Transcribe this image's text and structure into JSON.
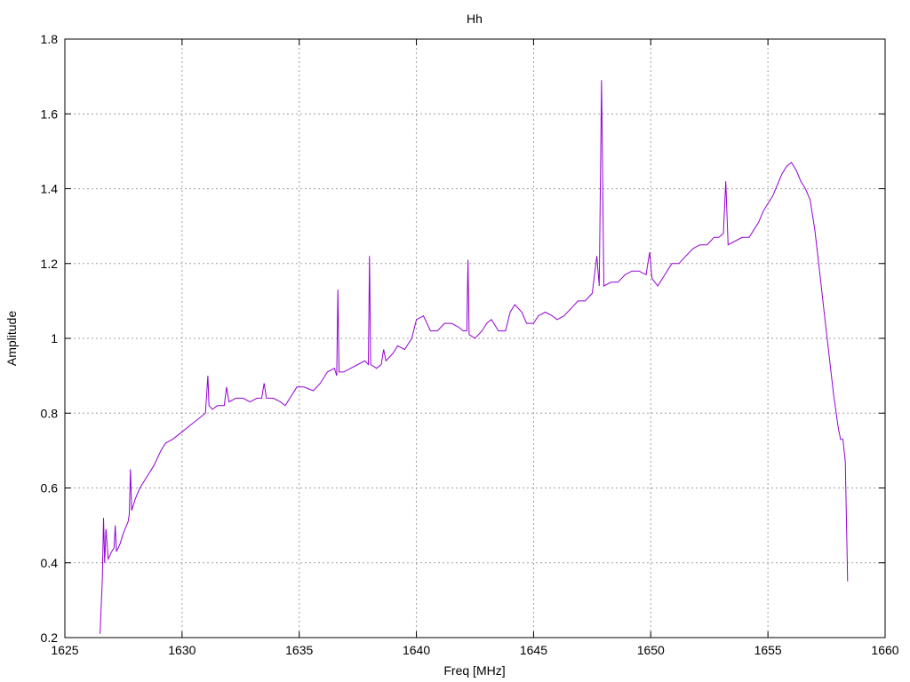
{
  "chart_data": {
    "type": "line",
    "title": "Hh",
    "xlabel": "Freq [MHz]",
    "ylabel": "Amplitude",
    "xlim": [
      1625,
      1660
    ],
    "ylim": [
      0.2,
      1.8
    ],
    "grid": true,
    "x_ticks": [
      {
        "value": 1625,
        "label": "1625"
      },
      {
        "value": 1630,
        "label": "1630"
      },
      {
        "value": 1635,
        "label": "1635"
      },
      {
        "value": 1640,
        "label": "1640"
      },
      {
        "value": 1645,
        "label": "1645"
      },
      {
        "value": 1650,
        "label": "1650"
      },
      {
        "value": 1655,
        "label": "1655"
      },
      {
        "value": 1660,
        "label": "1660"
      }
    ],
    "y_ticks": [
      {
        "value": 0.2,
        "label": "0.2"
      },
      {
        "value": 0.4,
        "label": "0.4"
      },
      {
        "value": 0.6,
        "label": "0.6"
      },
      {
        "value": 0.8,
        "label": "0.8"
      },
      {
        "value": 1.0,
        "label": "1"
      },
      {
        "value": 1.2,
        "label": "1.2"
      },
      {
        "value": 1.4,
        "label": "1.4"
      },
      {
        "value": 1.6,
        "label": "1.6"
      },
      {
        "value": 1.8,
        "label": "1.8"
      }
    ],
    "series": [
      {
        "color": "#9400d3",
        "points": [
          [
            1626.5,
            0.21
          ],
          [
            1626.6,
            0.36
          ],
          [
            1626.65,
            0.52
          ],
          [
            1626.7,
            0.4
          ],
          [
            1626.75,
            0.49
          ],
          [
            1626.85,
            0.41
          ],
          [
            1627.0,
            0.43
          ],
          [
            1627.1,
            0.44
          ],
          [
            1627.15,
            0.5
          ],
          [
            1627.2,
            0.43
          ],
          [
            1627.35,
            0.45
          ],
          [
            1627.5,
            0.48
          ],
          [
            1627.7,
            0.51
          ],
          [
            1627.75,
            0.53
          ],
          [
            1627.8,
            0.65
          ],
          [
            1627.85,
            0.54
          ],
          [
            1628.0,
            0.57
          ],
          [
            1628.2,
            0.6
          ],
          [
            1628.5,
            0.63
          ],
          [
            1628.8,
            0.66
          ],
          [
            1629.1,
            0.7
          ],
          [
            1629.3,
            0.72
          ],
          [
            1629.6,
            0.73
          ],
          [
            1630.0,
            0.75
          ],
          [
            1630.4,
            0.77
          ],
          [
            1630.8,
            0.79
          ],
          [
            1631.0,
            0.8
          ],
          [
            1631.1,
            0.9
          ],
          [
            1631.15,
            0.82
          ],
          [
            1631.3,
            0.81
          ],
          [
            1631.5,
            0.82
          ],
          [
            1631.8,
            0.82
          ],
          [
            1631.9,
            0.87
          ],
          [
            1632.0,
            0.83
          ],
          [
            1632.3,
            0.84
          ],
          [
            1632.6,
            0.84
          ],
          [
            1632.9,
            0.83
          ],
          [
            1633.2,
            0.84
          ],
          [
            1633.4,
            0.84
          ],
          [
            1633.5,
            0.88
          ],
          [
            1633.6,
            0.84
          ],
          [
            1633.9,
            0.84
          ],
          [
            1634.2,
            0.83
          ],
          [
            1634.4,
            0.82
          ],
          [
            1634.6,
            0.84
          ],
          [
            1634.9,
            0.87
          ],
          [
            1635.2,
            0.87
          ],
          [
            1635.6,
            0.86
          ],
          [
            1635.9,
            0.88
          ],
          [
            1636.2,
            0.91
          ],
          [
            1636.5,
            0.92
          ],
          [
            1636.6,
            0.9
          ],
          [
            1636.65,
            1.13
          ],
          [
            1636.7,
            0.91
          ],
          [
            1636.9,
            0.91
          ],
          [
            1637.2,
            0.92
          ],
          [
            1637.5,
            0.93
          ],
          [
            1637.8,
            0.94
          ],
          [
            1637.95,
            0.93
          ],
          [
            1638.0,
            1.22
          ],
          [
            1638.05,
            0.93
          ],
          [
            1638.3,
            0.92
          ],
          [
            1638.5,
            0.93
          ],
          [
            1638.6,
            0.97
          ],
          [
            1638.7,
            0.94
          ],
          [
            1639.0,
            0.96
          ],
          [
            1639.2,
            0.98
          ],
          [
            1639.5,
            0.97
          ],
          [
            1639.8,
            1.0
          ],
          [
            1640.0,
            1.05
          ],
          [
            1640.3,
            1.06
          ],
          [
            1640.6,
            1.02
          ],
          [
            1640.9,
            1.02
          ],
          [
            1641.2,
            1.04
          ],
          [
            1641.5,
            1.04
          ],
          [
            1641.8,
            1.03
          ],
          [
            1642.0,
            1.02
          ],
          [
            1642.15,
            1.02
          ],
          [
            1642.2,
            1.21
          ],
          [
            1642.25,
            1.01
          ],
          [
            1642.5,
            1.0
          ],
          [
            1642.8,
            1.02
          ],
          [
            1643.0,
            1.04
          ],
          [
            1643.2,
            1.05
          ],
          [
            1643.5,
            1.02
          ],
          [
            1643.8,
            1.02
          ],
          [
            1644.0,
            1.07
          ],
          [
            1644.2,
            1.09
          ],
          [
            1644.5,
            1.07
          ],
          [
            1644.7,
            1.04
          ],
          [
            1645.0,
            1.04
          ],
          [
            1645.2,
            1.06
          ],
          [
            1645.5,
            1.07
          ],
          [
            1645.8,
            1.06
          ],
          [
            1646.0,
            1.05
          ],
          [
            1646.3,
            1.06
          ],
          [
            1646.6,
            1.08
          ],
          [
            1646.9,
            1.1
          ],
          [
            1647.2,
            1.1
          ],
          [
            1647.5,
            1.12
          ],
          [
            1647.7,
            1.22
          ],
          [
            1647.8,
            1.14
          ],
          [
            1647.9,
            1.69
          ],
          [
            1648.0,
            1.14
          ],
          [
            1648.3,
            1.15
          ],
          [
            1648.6,
            1.15
          ],
          [
            1648.9,
            1.17
          ],
          [
            1649.2,
            1.18
          ],
          [
            1649.5,
            1.18
          ],
          [
            1649.8,
            1.17
          ],
          [
            1649.95,
            1.23
          ],
          [
            1650.05,
            1.16
          ],
          [
            1650.3,
            1.14
          ],
          [
            1650.6,
            1.17
          ],
          [
            1650.9,
            1.2
          ],
          [
            1651.2,
            1.2
          ],
          [
            1651.5,
            1.22
          ],
          [
            1651.8,
            1.24
          ],
          [
            1652.1,
            1.25
          ],
          [
            1652.4,
            1.25
          ],
          [
            1652.7,
            1.27
          ],
          [
            1652.9,
            1.27
          ],
          [
            1653.1,
            1.28
          ],
          [
            1653.2,
            1.42
          ],
          [
            1653.3,
            1.25
          ],
          [
            1653.6,
            1.26
          ],
          [
            1653.9,
            1.27
          ],
          [
            1654.2,
            1.27
          ],
          [
            1654.4,
            1.29
          ],
          [
            1654.6,
            1.31
          ],
          [
            1654.8,
            1.34
          ],
          [
            1655.0,
            1.36
          ],
          [
            1655.2,
            1.38
          ],
          [
            1655.4,
            1.41
          ],
          [
            1655.6,
            1.44
          ],
          [
            1655.8,
            1.46
          ],
          [
            1656.0,
            1.47
          ],
          [
            1656.2,
            1.45
          ],
          [
            1656.4,
            1.42
          ],
          [
            1656.6,
            1.4
          ],
          [
            1656.8,
            1.37
          ],
          [
            1657.0,
            1.29
          ],
          [
            1657.2,
            1.18
          ],
          [
            1657.4,
            1.07
          ],
          [
            1657.6,
            0.96
          ],
          [
            1657.8,
            0.85
          ],
          [
            1658.0,
            0.76
          ],
          [
            1658.1,
            0.73
          ],
          [
            1658.2,
            0.73
          ],
          [
            1658.3,
            0.67
          ],
          [
            1658.4,
            0.35
          ]
        ]
      }
    ]
  }
}
